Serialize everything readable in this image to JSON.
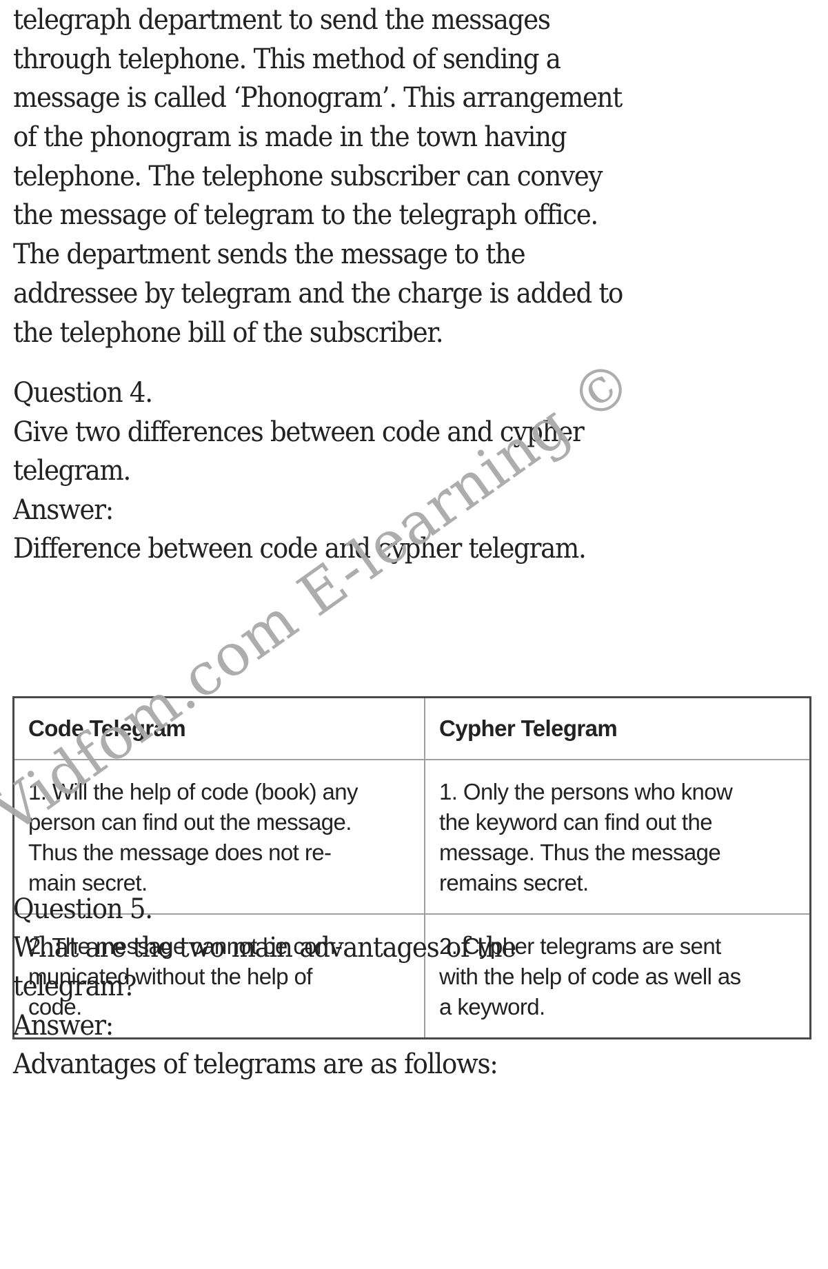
{
  "intro_paragraph": {
    "lines": [
      "telegraph department to send the messages",
      "through telephone. This method of sending a",
      "message is called ‘Phonogram’. This arrangement",
      "of the phonogram is made in the town having",
      "telephone. The telephone subscriber can convey",
      "the message of telegram to the telegraph office.",
      "The department sends the message to the",
      "addressee by telegram and the charge is added to",
      "the telephone bill of the subscriber."
    ]
  },
  "question4": {
    "heading": "Question 4.",
    "question_lines": [
      "Give two differences between code and cypher",
      "telegram."
    ],
    "answer_label": "Answer:",
    "answer_intro": "Difference between code and cypher telegram.",
    "table": {
      "headers": [
        "Code Telegram",
        "Cypher Telegram"
      ],
      "rows": [
        {
          "code_lines": [
            "1. Will the help of code (book) any",
            "person can find out the message.",
            "Thus the message does not re-",
            "main secret."
          ],
          "cypher_lines": [
            "1. Only the persons who know",
            "the keyword can find out the",
            "message. Thus the message",
            "remains secret."
          ]
        },
        {
          "code_lines": [
            "2. The message cannot be com-",
            "municated without the help of",
            "code."
          ],
          "cypher_lines": [
            "2. Cypher telegrams are sent",
            "with the help of code as well as",
            "a keyword."
          ]
        }
      ]
    }
  },
  "question5": {
    "heading": "Question 5.",
    "question_lines": [
      "What are the two main advantages of the",
      "telegram?"
    ],
    "answer_label": "Answer:",
    "answer_intro": "Advantages of telegrams are as follows:"
  },
  "watermark": {
    "text": "Vidfom.com E-learning ©",
    "color": "#a9a9a9"
  }
}
